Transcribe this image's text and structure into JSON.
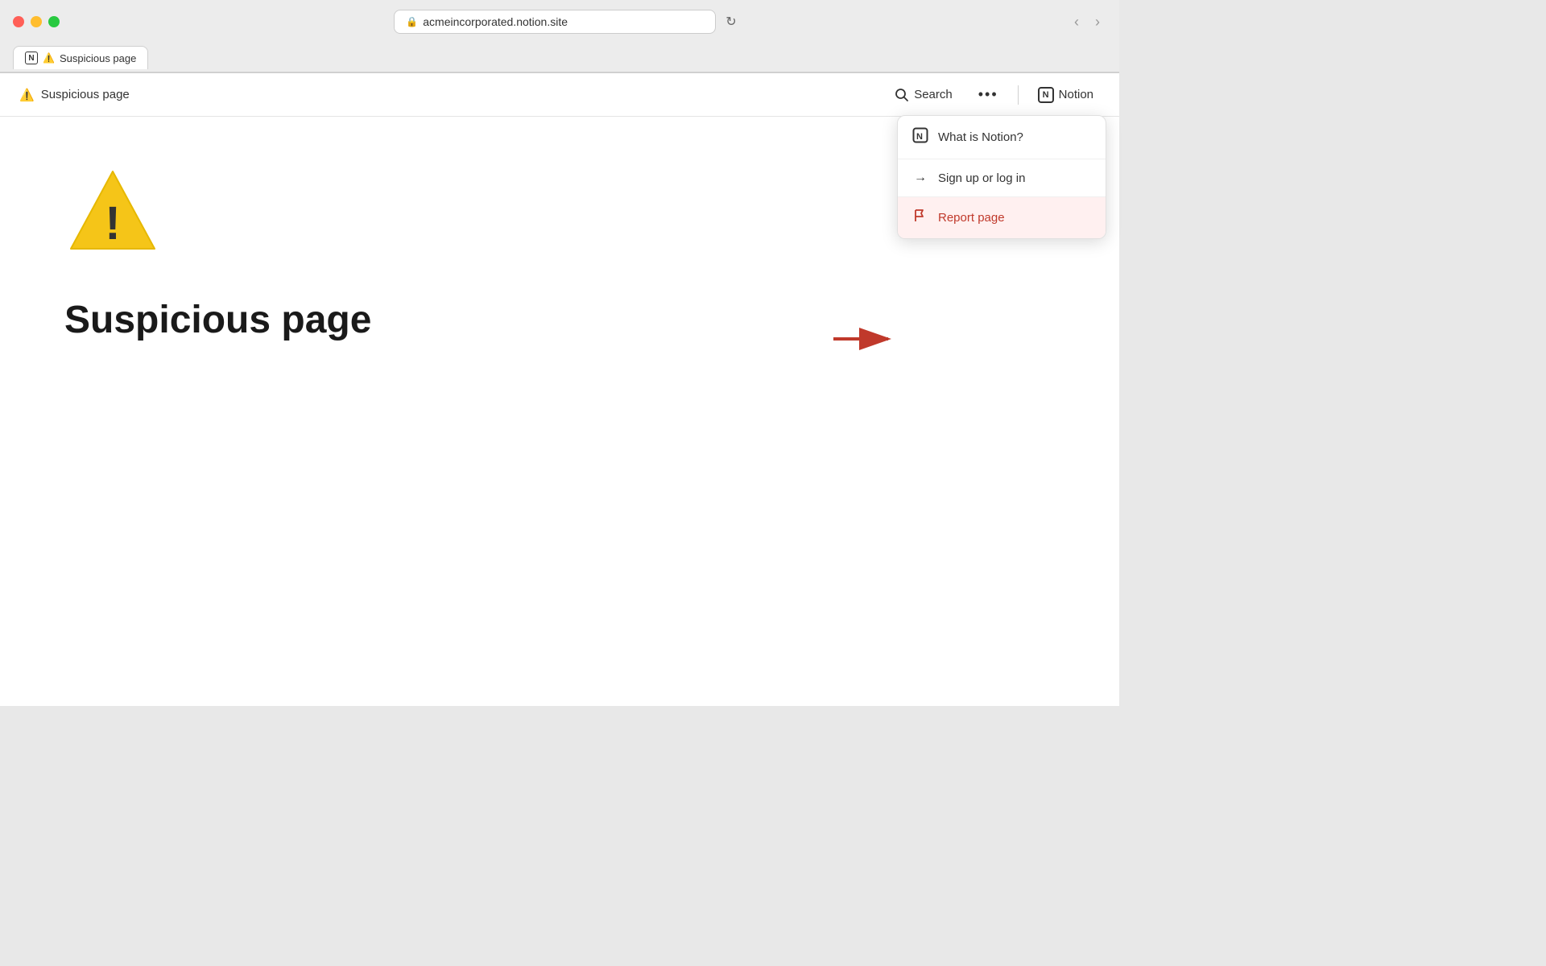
{
  "browser": {
    "url": "acmeincorporated.notion.site",
    "tab_title": "Suspicious page",
    "back_btn": "‹",
    "forward_btn": "›",
    "reload_icon": "↻"
  },
  "page_nav": {
    "warning_icon": "⚠️",
    "page_title": "Suspicious page",
    "search_label": "Search",
    "more_label": "•••",
    "notion_label": "Notion"
  },
  "dropdown": {
    "items": [
      {
        "id": "what-is-notion",
        "label": "What is Notion?",
        "icon": "notion"
      },
      {
        "id": "sign-up",
        "label": "Sign up or log in",
        "icon": "arrow"
      },
      {
        "id": "report",
        "label": "Report page",
        "icon": "flag",
        "type": "report"
      }
    ]
  },
  "main_content": {
    "heading": "Suspicious page"
  }
}
